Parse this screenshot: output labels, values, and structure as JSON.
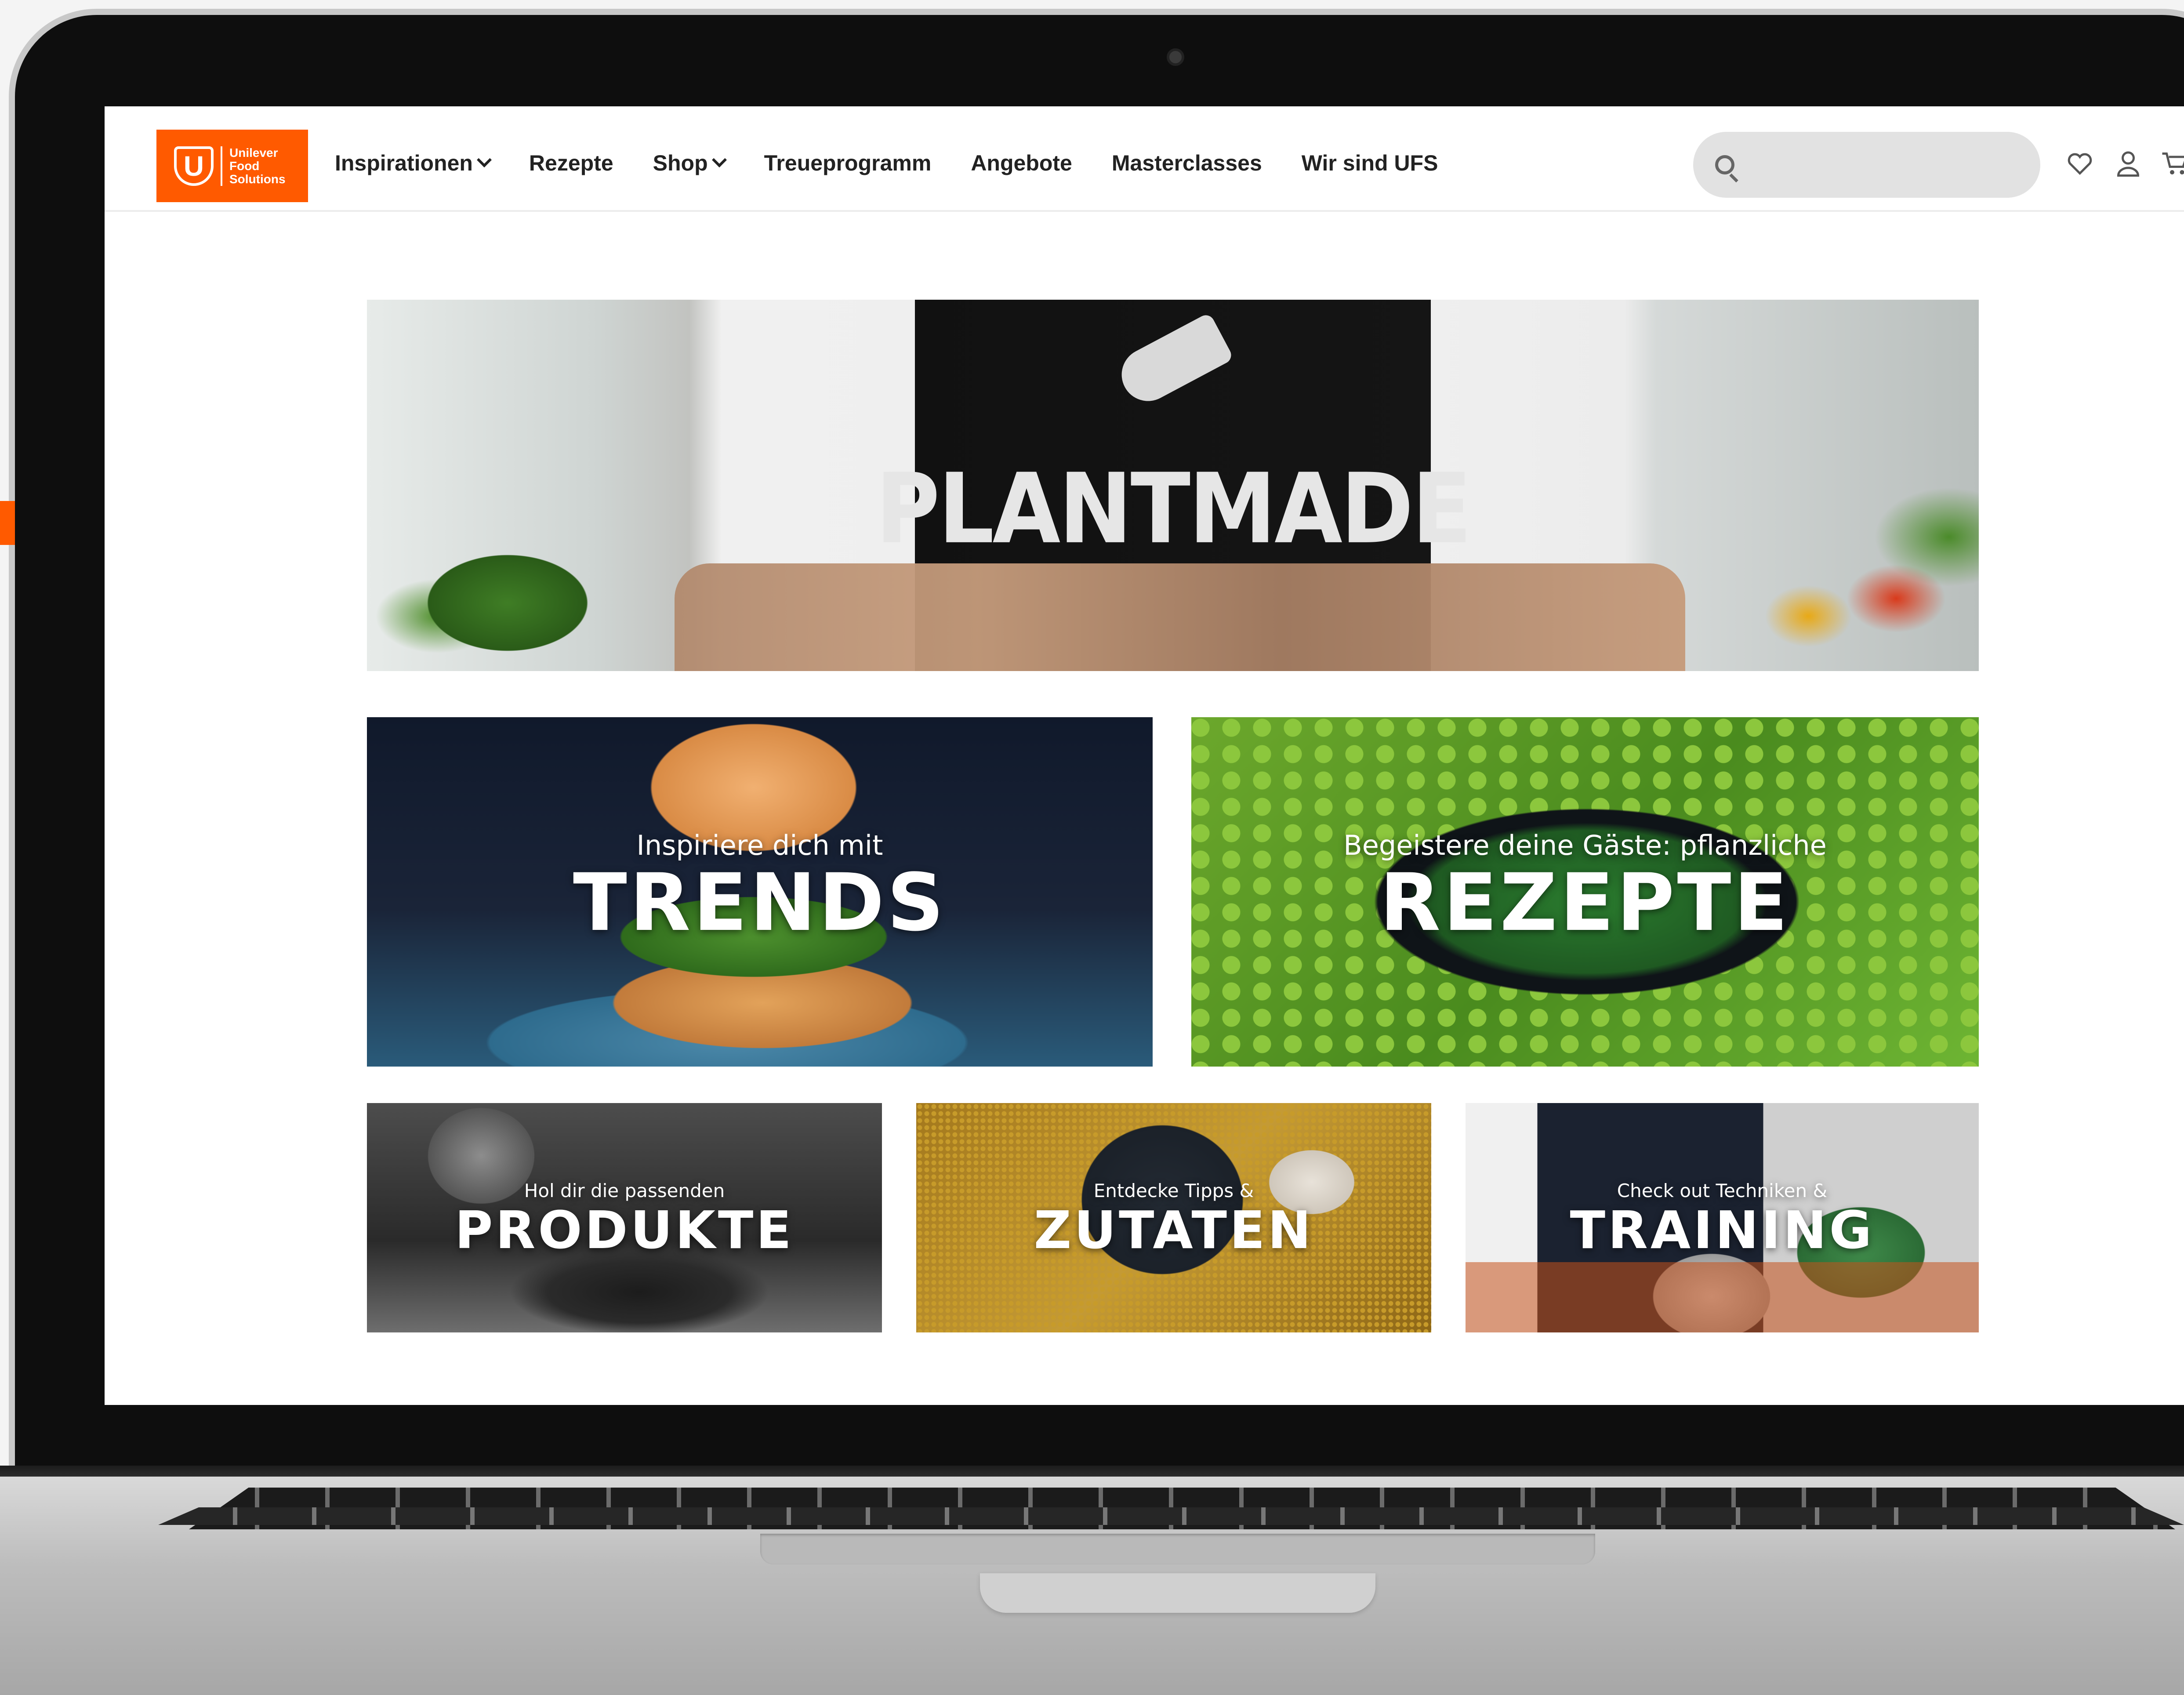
{
  "brand": {
    "name": "Unilever Food Solutions",
    "logo_lines": [
      "Unilever",
      "Food",
      "Solutions"
    ],
    "color": "#ff5a00"
  },
  "nav": {
    "items": [
      {
        "label": "Inspirationen",
        "has_dropdown": true
      },
      {
        "label": "Rezepte",
        "has_dropdown": false
      },
      {
        "label": "Shop",
        "has_dropdown": true
      },
      {
        "label": "Treueprogramm",
        "has_dropdown": false
      },
      {
        "label": "Angebote",
        "has_dropdown": false
      },
      {
        "label": "Masterclasses",
        "has_dropdown": false
      },
      {
        "label": "Wir sind UFS",
        "has_dropdown": false
      }
    ]
  },
  "search": {
    "placeholder": "",
    "value": "",
    "icon": "search-icon"
  },
  "header_icons": [
    "heart-icon",
    "user-icon",
    "cart-icon"
  ],
  "hero": {
    "title": "PLANTMADE"
  },
  "tiles": [
    {
      "kicker": "Inspiriere dich mit",
      "title": "TRENDS"
    },
    {
      "kicker": "Begeistere deine Gäste: pflanzliche",
      "title": "REZEPTE"
    },
    {
      "kicker": "Hol dir die passenden",
      "title": "PRODUKTE"
    },
    {
      "kicker": "Entdecke Tipps &",
      "title": "ZUTATEN"
    },
    {
      "kicker": "Check out Techniken &",
      "title": "TRAINING"
    }
  ]
}
